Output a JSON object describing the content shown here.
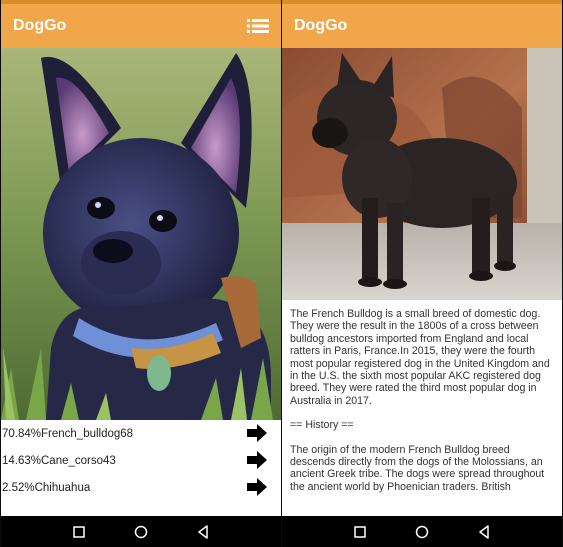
{
  "left_screen": {
    "app_title": "DogGo",
    "menu_icon": "list-menu-icon",
    "photo_icon": "french-bulldog-closeup-photo",
    "predictions": [
      {
        "label": "70.84%French_bulldog68"
      },
      {
        "label": "14.63%Cane_corso43"
      },
      {
        "label": "2.52%Chihuahua"
      }
    ]
  },
  "right_screen": {
    "app_title": "DogGo",
    "photo_icon": "french-bulldog-standing-photo",
    "description": "The French Bulldog is a small breed of domestic dog. They were the result in the 1800s of a cross between bulldog ancestors imported from England and local ratters in Paris, France.In 2015, they were the fourth most popular registered dog in the United Kingdom and in the U.S. the sixth most popular AKC registered dog breed. They were rated the third most popular dog in Australia in 2017.",
    "history_heading": "== History ==",
    "history_text": "The origin of the modern French Bulldog breed descends directly from the dogs of the Molossians, an ancient Greek tribe. The dogs were spread throughout the ancient world by Phoenician traders. British"
  },
  "navigation": {
    "buttons": [
      "square-recents-icon",
      "circle-home-icon",
      "triangle-back-icon"
    ]
  },
  "colors": {
    "appbar": "#f1a64a",
    "statusbar": "#d98c2b",
    "navbar": "#000000"
  }
}
